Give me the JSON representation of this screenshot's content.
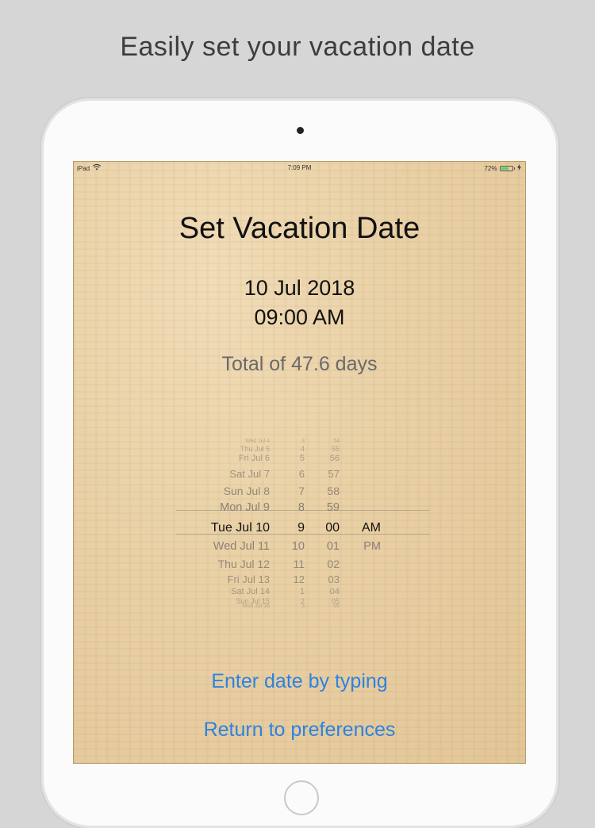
{
  "headline": "Easily set your vacation date",
  "statusbar": {
    "device": "iPad",
    "wifi_icon": "wifi-icon",
    "time": "7:09 PM",
    "battery_pct": "72%",
    "battery_level": 0.72,
    "battery_color": "#4cd964"
  },
  "screen": {
    "title": "Set Vacation Date",
    "date": "10 Jul 2018",
    "time": "09:00 AM",
    "total": "Total of 47.6 days"
  },
  "picker": {
    "rows": [
      {
        "date": "Wed Jul 4",
        "hour": "3",
        "minute": "54",
        "ampm": ""
      },
      {
        "date": "Thu Jul 5",
        "hour": "4",
        "minute": "55",
        "ampm": ""
      },
      {
        "date": "Fri Jul 6",
        "hour": "5",
        "minute": "56",
        "ampm": ""
      },
      {
        "date": "Sat Jul 7",
        "hour": "6",
        "minute": "57",
        "ampm": ""
      },
      {
        "date": "Sun Jul 8",
        "hour": "7",
        "minute": "58",
        "ampm": ""
      },
      {
        "date": "Mon Jul 9",
        "hour": "8",
        "minute": "59",
        "ampm": ""
      },
      {
        "date": "Tue Jul 10",
        "hour": "9",
        "minute": "00",
        "ampm": "AM"
      },
      {
        "date": "Wed Jul 11",
        "hour": "10",
        "minute": "01",
        "ampm": "PM"
      },
      {
        "date": "Thu Jul 12",
        "hour": "11",
        "minute": "02",
        "ampm": ""
      },
      {
        "date": "Fri Jul 13",
        "hour": "12",
        "minute": "03",
        "ampm": ""
      },
      {
        "date": "Sat Jul 14",
        "hour": "1",
        "minute": "04",
        "ampm": ""
      },
      {
        "date": "Sun Jul 15",
        "hour": "2",
        "minute": "05",
        "ampm": ""
      },
      {
        "date": "Mon Jul 16",
        "hour": "3",
        "minute": "06",
        "ampm": ""
      }
    ],
    "selected_index": 6
  },
  "links": {
    "enter_by_typing": "Enter date by typing",
    "return_to_prefs": "Return to preferences"
  },
  "colors": {
    "link": "#2b83e0",
    "background": "#d6d6d6"
  }
}
